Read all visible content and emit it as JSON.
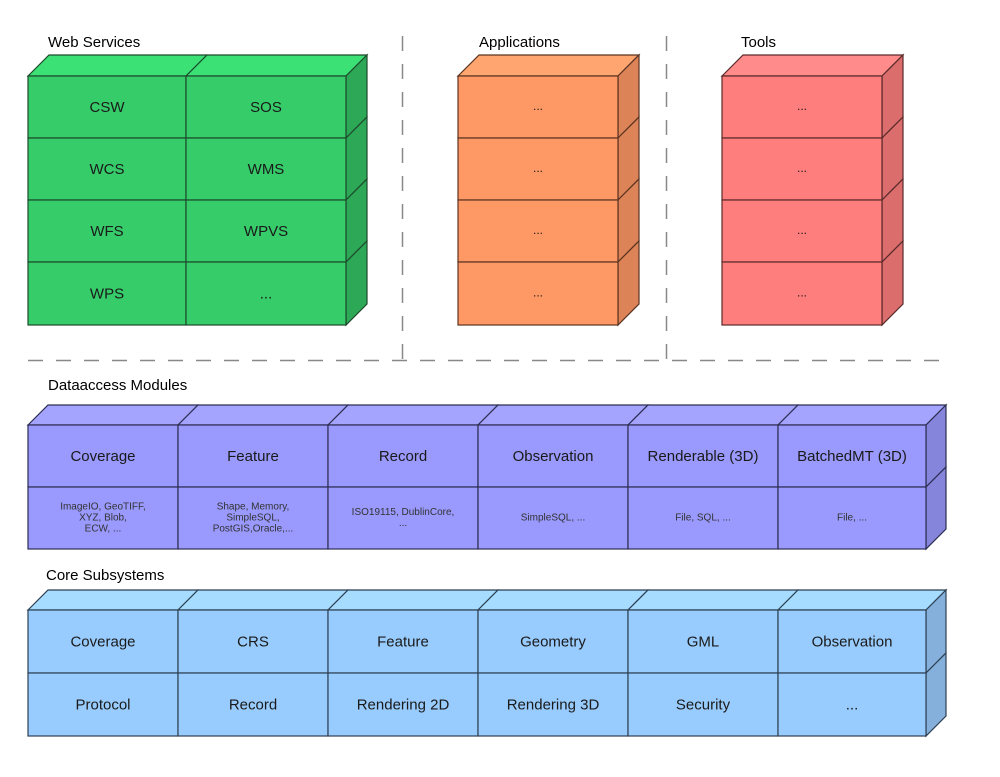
{
  "diagram": {
    "sections": {
      "web_services": {
        "title": "Web Services",
        "colors": {
          "front": "#36cc6a",
          "top": "#3be174",
          "side": "#2ca857",
          "stroke": "#1d4a2c"
        },
        "columns": 2,
        "cells": [
          [
            "CSW",
            "SOS"
          ],
          [
            "WCS",
            "WMS"
          ],
          [
            "WFS",
            "WPVS"
          ],
          [
            "WPS",
            "..."
          ]
        ]
      },
      "applications": {
        "title": "Applications",
        "colors": {
          "front": "#fe9966",
          "top": "#ffa56f",
          "side": "#dc8457",
          "stroke": "#5a3320"
        },
        "columns": 1,
        "cells": [
          [
            "..."
          ],
          [
            "..."
          ],
          [
            "..."
          ],
          [
            "..."
          ]
        ]
      },
      "tools": {
        "title": "Tools",
        "colors": {
          "front": "#fe7e7e",
          "top": "#ff8b8b",
          "side": "#db6d6d",
          "stroke": "#5a2a2a"
        },
        "columns": 1,
        "cells": [
          [
            "..."
          ],
          [
            "..."
          ],
          [
            "..."
          ],
          [
            "..."
          ]
        ]
      },
      "dataaccess": {
        "title": "Dataaccess Modules",
        "colors": {
          "front": "#9999fe",
          "top": "#a4a4ff",
          "side": "#8585dc",
          "stroke": "#2d2d52"
        },
        "modules": [
          {
            "name": "Coverage",
            "backends": [
              "ImageIO, GeoTIFF,",
              "XYZ, Blob,",
              "ECW, ..."
            ]
          },
          {
            "name": "Feature",
            "backends": [
              "Shape, Memory,",
              "SimpleSQL,",
              "PostGIS,Oracle,..."
            ]
          },
          {
            "name": "Record",
            "backends": [
              "ISO19115, DublinCore,",
              "..."
            ]
          },
          {
            "name": "Observation",
            "backends": [
              "SimpleSQL, ..."
            ]
          },
          {
            "name": "Renderable (3D)",
            "backends": [
              "File, SQL, ..."
            ]
          },
          {
            "name": "BatchedMT (3D)",
            "backends": [
              "File, ..."
            ]
          }
        ]
      },
      "core": {
        "title": "Core Subsystems",
        "colors": {
          "front": "#99ccfe",
          "top": "#a6dcff",
          "side": "#85b0dc",
          "stroke": "#2d3f52"
        },
        "rows": [
          [
            "Coverage",
            "CRS",
            "Feature",
            "Geometry",
            "GML",
            "Observation"
          ],
          [
            "Protocol",
            "Record",
            "Rendering 2D",
            "Rendering 3D",
            "Security",
            "..."
          ]
        ]
      }
    },
    "separator_color": "#888888"
  }
}
